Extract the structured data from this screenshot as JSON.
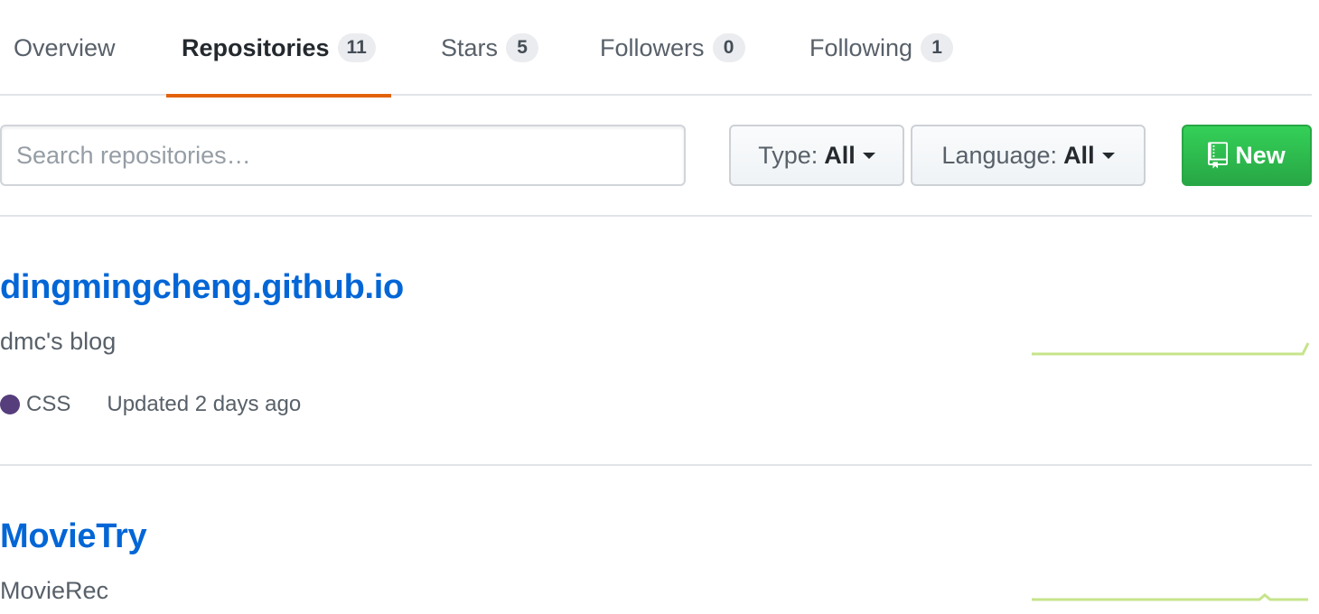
{
  "tabs": [
    {
      "label": "Overview",
      "count": null,
      "selected": false
    },
    {
      "label": "Repositories",
      "count": "11",
      "selected": true
    },
    {
      "label": "Stars",
      "count": "5",
      "selected": false
    },
    {
      "label": "Followers",
      "count": "0",
      "selected": false
    },
    {
      "label": "Following",
      "count": "1",
      "selected": false
    }
  ],
  "filters": {
    "search_placeholder": "Search repositories…",
    "type_label": "Type:",
    "type_value": "All",
    "language_label": "Language:",
    "language_value": "All",
    "new_label": "New"
  },
  "repos": [
    {
      "name": "dingmingcheng.github.io",
      "description": "dmc's blog",
      "language": "CSS",
      "language_color": "#563d7c",
      "updated": "Updated 2 days ago",
      "sparkline_icon": "activity-graph"
    },
    {
      "name": "MovieTry",
      "description": "MovieRec",
      "sparkline_icon": "activity-graph"
    }
  ],
  "colors": {
    "link": "#0366d6",
    "selected_tab_underline": "#e36209",
    "new_button": "#28a745",
    "sparkline": "#c6e48b"
  }
}
